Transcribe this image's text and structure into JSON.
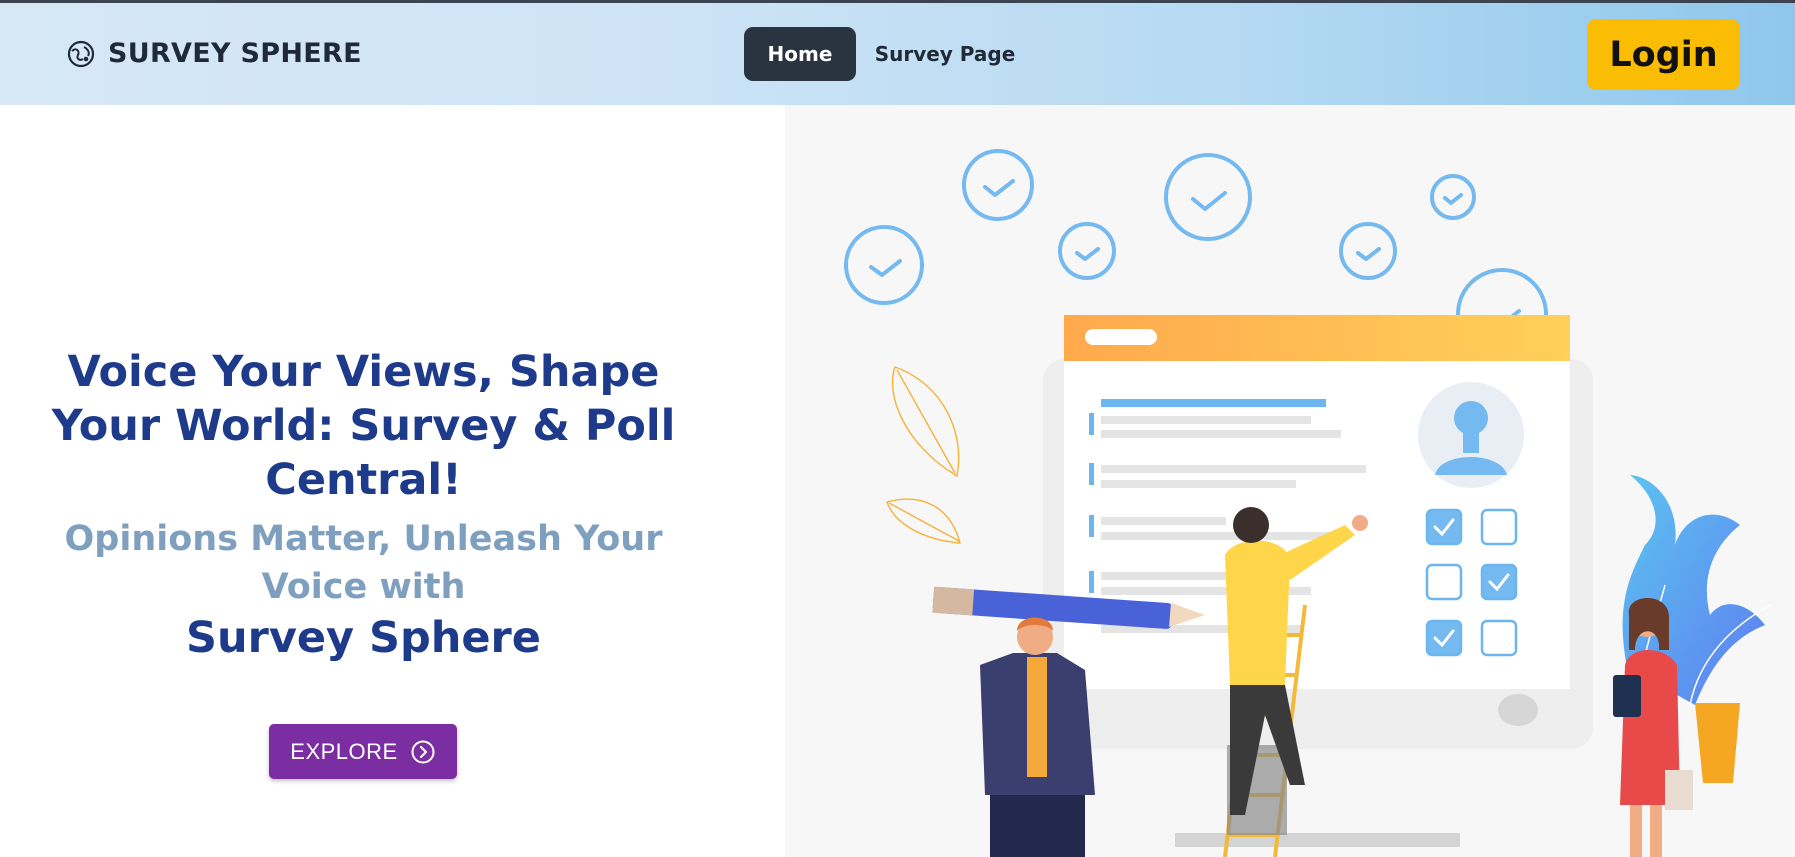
{
  "navbar": {
    "brand": "SURVEY SPHERE",
    "brand_icon": "globe-icon",
    "links": [
      {
        "label": "Home",
        "active": true
      },
      {
        "label": "Survey Page",
        "active": false
      }
    ],
    "login_label": "Login"
  },
  "hero": {
    "headline": "Voice Your Views, Shape Your World: Survey & Poll Central!",
    "subheadline": "Opinions Matter, Unleash Your Voice with",
    "brand_name": "Survey Sphere",
    "cta_label": "EXPLORE",
    "cta_icon": "chevron-right-circle-icon"
  },
  "colors": {
    "accent_dark": "#1e3a8a",
    "sub_text": "#7f9fbf",
    "cta": "#7b2ea1",
    "login": "#fbbc04",
    "nav_active": "#2a3340"
  }
}
